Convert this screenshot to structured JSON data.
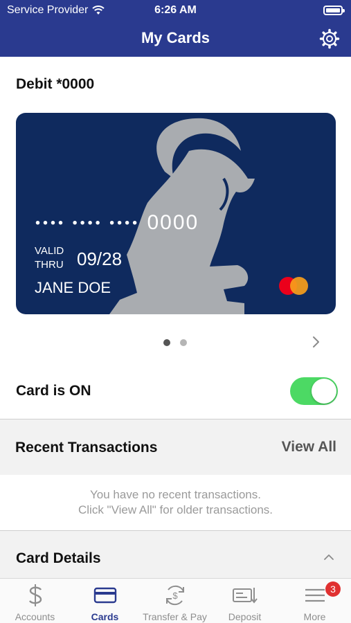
{
  "status_bar": {
    "carrier": "Service Provider",
    "time": "6:26 AM"
  },
  "nav": {
    "title": "My Cards",
    "settings_icon": "gear-icon"
  },
  "card_section": {
    "heading": "Debit *0000",
    "card": {
      "masked_dots": "•••• •••• ••••",
      "last4": "0000",
      "valid_label": "VALID THRU",
      "expiry": "09/28",
      "holder": "JANE DOE",
      "network_logo": "mastercard-logo",
      "background_color": "#0f2a5e"
    },
    "pager": {
      "current": 1,
      "total": 2
    }
  },
  "card_toggle": {
    "label": "Card is ON",
    "on": true,
    "on_color": "#4cd964"
  },
  "recent_transactions": {
    "title": "Recent Transactions",
    "view_all": "View All",
    "empty_line1": "You have no recent transactions.",
    "empty_line2": "Click \"View All\" for older transactions."
  },
  "card_details": {
    "title": "Card Details",
    "expanded": true
  },
  "tab_bar": {
    "tabs": [
      {
        "label": "Accounts",
        "icon": "dollar-icon",
        "active": false
      },
      {
        "label": "Cards",
        "icon": "credit-card-icon",
        "active": true
      },
      {
        "label": "Transfer & Pay",
        "icon": "transfer-icon",
        "active": false
      },
      {
        "label": "Deposit",
        "icon": "check-deposit-icon",
        "active": false
      },
      {
        "label": "More",
        "icon": "menu-icon",
        "active": false,
        "badge": "3"
      }
    ],
    "active_color": "#2a3a8f"
  },
  "theme": {
    "brand": "#2a3a8f"
  }
}
